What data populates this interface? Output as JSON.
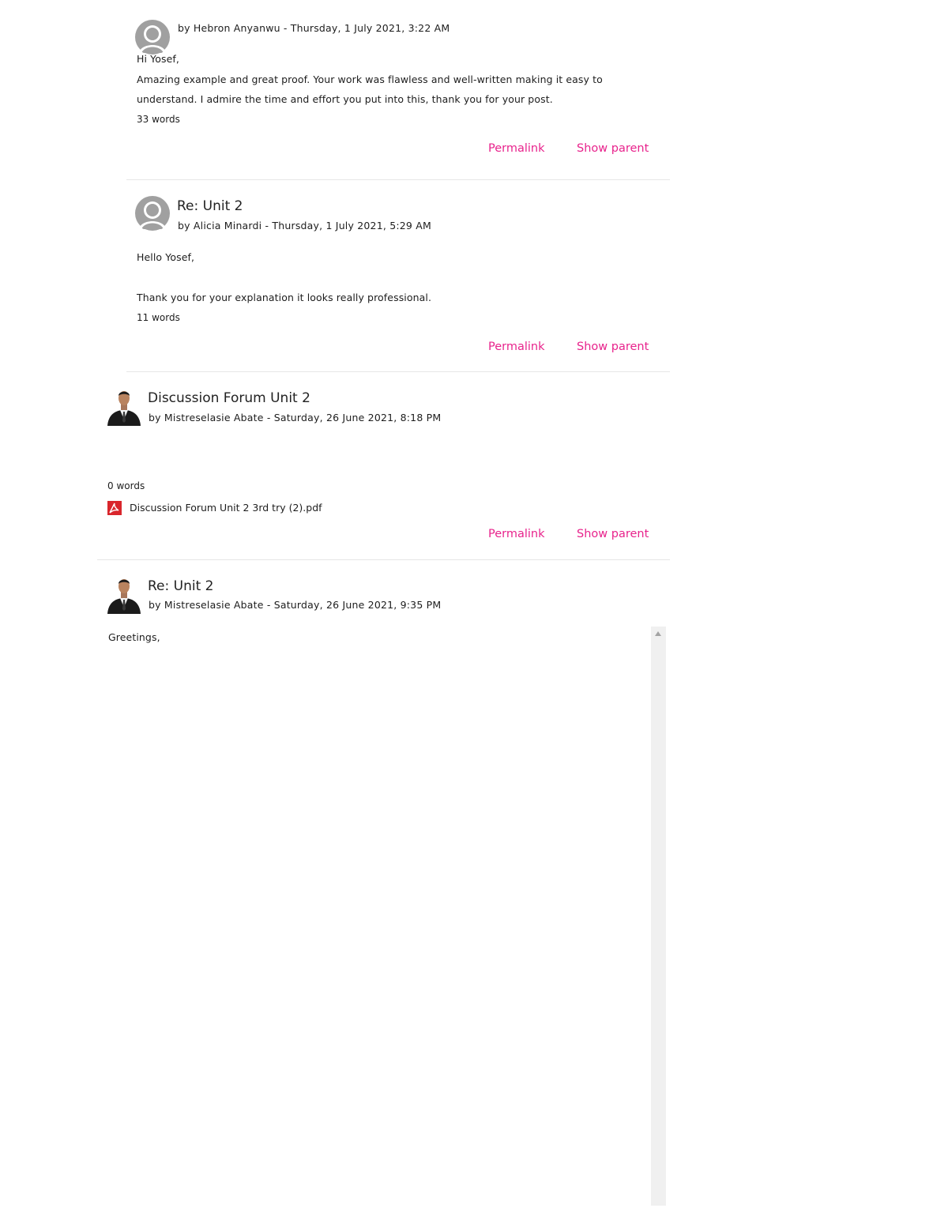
{
  "posts": [
    {
      "subject": "",
      "byline": "by Hebron Anyanwu - Thursday, 1 July 2021, 3:22 AM",
      "body": [
        "Hi Yosef,",
        "Amazing example and great proof. Your work was flawless and well-written making it easy to",
        "understand. I admire the time and effort you put into this, thank you for your post."
      ],
      "words": "33 words",
      "permalink": "Permalink",
      "show_parent": "Show parent"
    },
    {
      "subject": "Re: Unit 2",
      "byline": "by Alicia Minardi - Thursday, 1 July 2021, 5:29 AM",
      "body": [
        "Hello Yosef,",
        "Thank you for your explanation it looks really professional."
      ],
      "words": "11 words",
      "permalink": "Permalink",
      "show_parent": "Show parent"
    },
    {
      "subject": "Discussion Forum Unit 2",
      "byline": "by Mistreselasie Abate - Saturday, 26 June 2021, 8:18 PM",
      "words": "0 words",
      "attachment": "Discussion Forum Unit 2 3rd try (2).pdf",
      "permalink": "Permalink",
      "show_parent": "Show parent"
    },
    {
      "subject": "Re: Unit 2",
      "byline": "by Mistreselasie Abate - Saturday, 26 June 2021, 9:35 PM",
      "body": [
        "Greetings,"
      ]
    }
  ],
  "colors": {
    "link": "#e8238c",
    "divider": "#e6e6e6",
    "scrollbar_track": "#f0f0f0",
    "pdf_icon": "#d9262c"
  },
  "icons": {
    "default_avatar": "user-silhouette-icon",
    "user_avatar": "user-photo-avatar",
    "attachment": "pdf-file-icon",
    "scroll_up": "scroll-up-arrow-icon"
  }
}
